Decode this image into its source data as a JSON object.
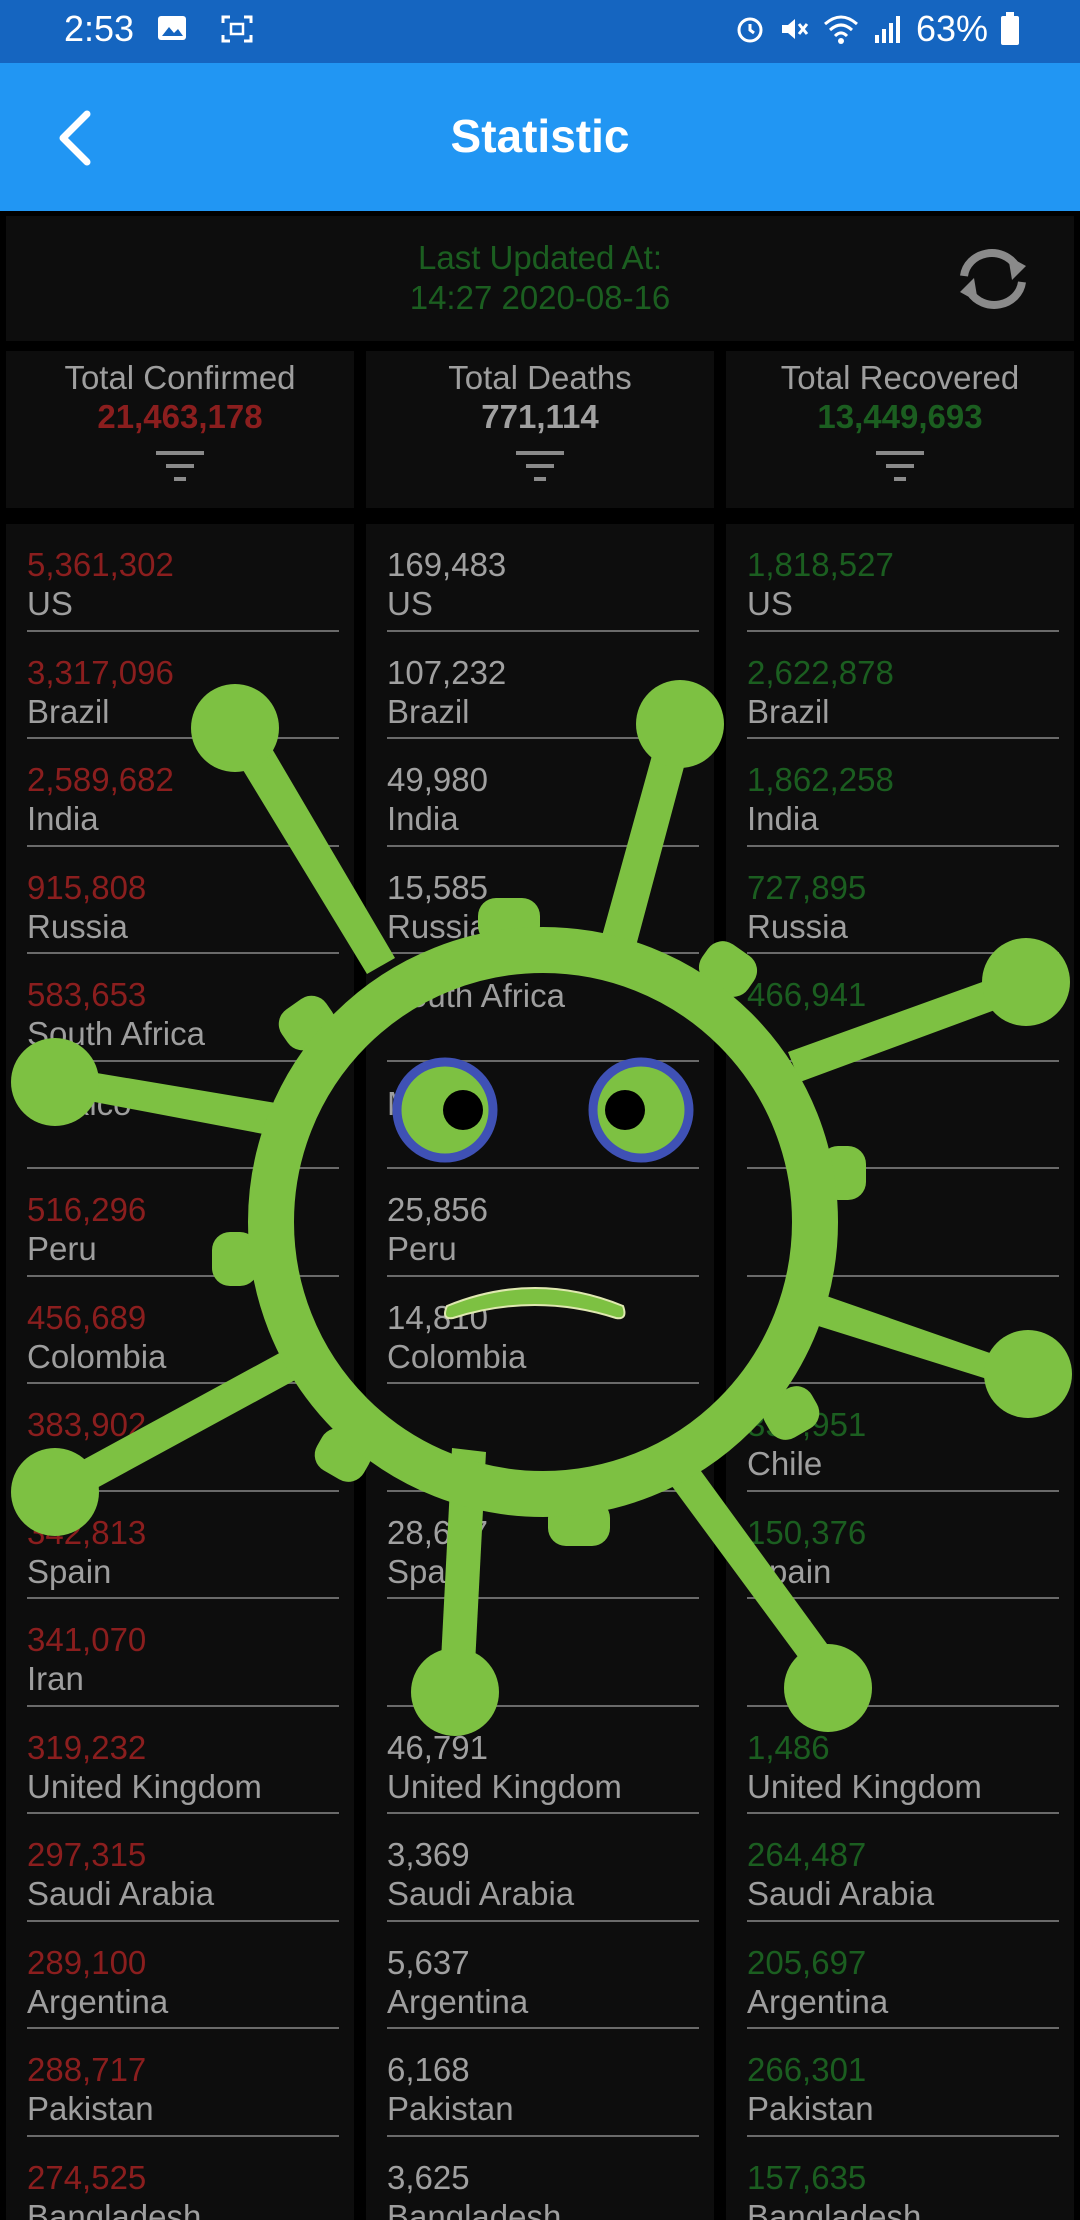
{
  "status_bar": {
    "time": "2:53",
    "battery": "63%",
    "icons": [
      "image-icon",
      "screenshot-icon",
      "alarm-icon",
      "mute-icon",
      "wifi-icon",
      "signal-icon",
      "battery-icon"
    ]
  },
  "app_bar": {
    "title": "Statistic",
    "background": "#2196f3"
  },
  "update": {
    "label": "Last Updated At:",
    "timestamp": "14:27 2020-08-16"
  },
  "summary": {
    "confirmed": {
      "label": "Total Confirmed",
      "value": "21,463,178",
      "color": "#8b1e1e"
    },
    "deaths": {
      "label": "Total Deaths",
      "value": "771,114",
      "color": "#a0a0a0"
    },
    "recovered": {
      "label": "Total Recovered",
      "value": "13,449,693",
      "color": "#1b5e20"
    }
  },
  "columns": {
    "confirmed": [
      {
        "value": "5,361,302",
        "country": "US"
      },
      {
        "value": "3,317,096",
        "country": "Brazil"
      },
      {
        "value": "2,589,682",
        "country": "India"
      },
      {
        "value": "915,808",
        "country": "Russia"
      },
      {
        "value": "583,653",
        "country": "South Africa"
      },
      {
        "value": "",
        "country": "Mexico"
      },
      {
        "value": "516,296",
        "country": "Peru"
      },
      {
        "value": "456,689",
        "country": "Colombia"
      },
      {
        "value": "383,902",
        "country": ""
      },
      {
        "value": "342,813",
        "country": "Spain"
      },
      {
        "value": "341,070",
        "country": "Iran"
      },
      {
        "value": "319,232",
        "country": "United Kingdom"
      },
      {
        "value": "297,315",
        "country": "Saudi Arabia"
      },
      {
        "value": "289,100",
        "country": "Argentina"
      },
      {
        "value": "288,717",
        "country": "Pakistan"
      },
      {
        "value": "274,525",
        "country": "Bangladesh"
      }
    ],
    "deaths": [
      {
        "value": "169,483",
        "country": "US"
      },
      {
        "value": "107,232",
        "country": "Brazil"
      },
      {
        "value": "49,980",
        "country": "India"
      },
      {
        "value": "15,585",
        "country": "Russia"
      },
      {
        "value": "",
        "country": "South Africa"
      },
      {
        "value": "",
        "country": "Mexico"
      },
      {
        "value": "25,856",
        "country": "Peru"
      },
      {
        "value": "14,810",
        "country": "Colombia"
      },
      {
        "value": "",
        "country": ""
      },
      {
        "value": "28,617",
        "country": "Spain"
      },
      {
        "value": "",
        "country": ""
      },
      {
        "value": "46,791",
        "country": "United Kingdom"
      },
      {
        "value": "3,369",
        "country": "Saudi Arabia"
      },
      {
        "value": "5,637",
        "country": "Argentina"
      },
      {
        "value": "6,168",
        "country": "Pakistan"
      },
      {
        "value": "3,625",
        "country": "Bangladesh"
      }
    ],
    "recovered": [
      {
        "value": "1,818,527",
        "country": "US"
      },
      {
        "value": "2,622,878",
        "country": "Brazil"
      },
      {
        "value": "1,862,258",
        "country": "India"
      },
      {
        "value": "727,895",
        "country": "Russia"
      },
      {
        "value": "466,941",
        "country": ""
      },
      {
        "value": "",
        "country": ""
      },
      {
        "value": "",
        "country": ""
      },
      {
        "value": "",
        "country": ""
      },
      {
        "value": "356,951",
        "country": "Chile"
      },
      {
        "value": "150,376",
        "country": "Spain"
      },
      {
        "value": "",
        "country": ""
      },
      {
        "value": "1,486",
        "country": "United Kingdom"
      },
      {
        "value": "264,487",
        "country": "Saudi Arabia"
      },
      {
        "value": "205,697",
        "country": "Argentina"
      },
      {
        "value": "266,301",
        "country": "Pakistan"
      },
      {
        "value": "157,635",
        "country": "Bangladesh"
      }
    ]
  },
  "colors": {
    "virus": "#7dc142",
    "eye_ring": "#3f51b5"
  }
}
